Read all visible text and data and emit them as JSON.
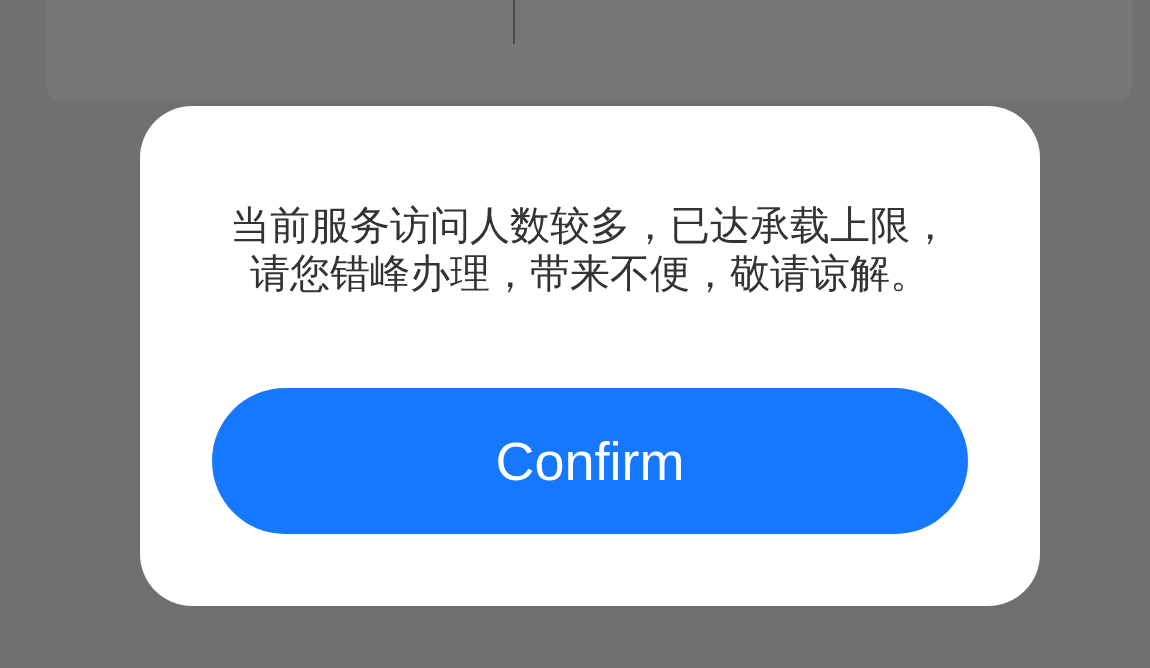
{
  "dialog": {
    "message": "当前服务访问人数较多，已达承载上限，请您错峰办理，带来不便，敬请谅解。",
    "button": "Confirm"
  }
}
